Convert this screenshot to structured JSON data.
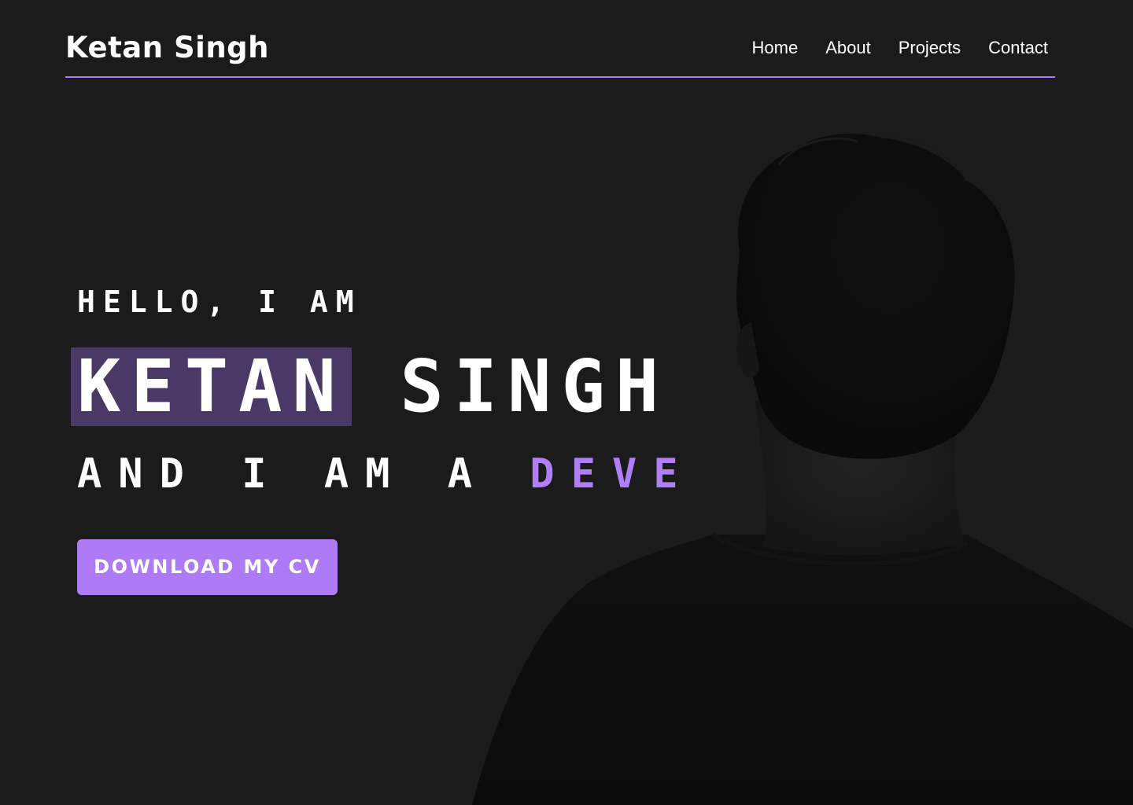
{
  "header": {
    "brand": "Ketan Singh",
    "nav": [
      {
        "label": "Home"
      },
      {
        "label": "About"
      },
      {
        "label": "Projects"
      },
      {
        "label": "Contact"
      }
    ]
  },
  "hero": {
    "greeting": "HELLO, I AM",
    "name": "KETAN SINGH",
    "role_prefix": "AND I AM A ",
    "role_typed": "DEVE",
    "cta_label": "DOWNLOAD MY CV"
  },
  "colors": {
    "background": "#1b1b1b",
    "accent": "#ad7bf6",
    "highlight": "#4a3867",
    "text": "#ffffff"
  }
}
